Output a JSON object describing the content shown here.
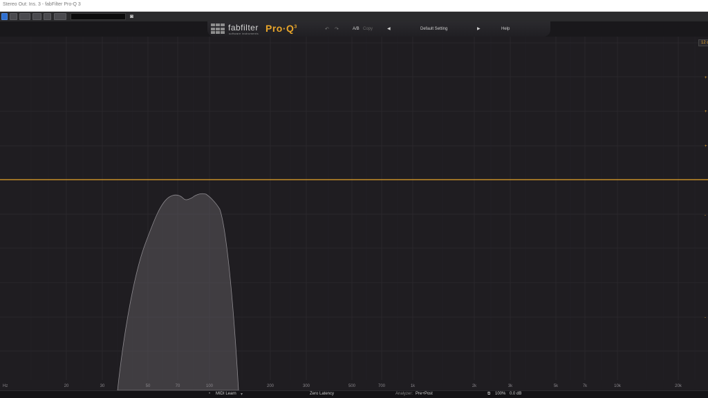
{
  "window": {
    "title": "Stereo Out: Ins. 3 - fabFilter Pro-Q 3"
  },
  "header": {
    "brand": "fabfilter",
    "brand_sub": "software instruments",
    "product": "Pro·Q",
    "product_version": "3",
    "ab_label": "A/B",
    "copy_label": "Copy",
    "preset_name": "Default Setting",
    "help_label": "Help"
  },
  "display": {
    "range_badge": "12 d",
    "freq_labels": [
      "Hz",
      "20",
      "30",
      "50",
      "70",
      "100",
      "200",
      "300",
      "500",
      "700",
      "1k",
      "2k",
      "3k",
      "5k",
      "7k",
      "10k",
      "20k"
    ],
    "db_tick_labels": [
      "+",
      "+",
      "+",
      "-",
      "-"
    ],
    "colors": {
      "eq_curve": "#e8a52a",
      "analyzer_fill": "#5b585d",
      "grid": "#2c2a2f"
    }
  },
  "bottombar": {
    "midi_learn": "MIDI Learn",
    "latency": "Zero Latency",
    "analyzer_label": "Analyzer:",
    "analyzer_value": "Pre+Post",
    "zoom": "100%",
    "gain": "0.0 dB"
  }
}
